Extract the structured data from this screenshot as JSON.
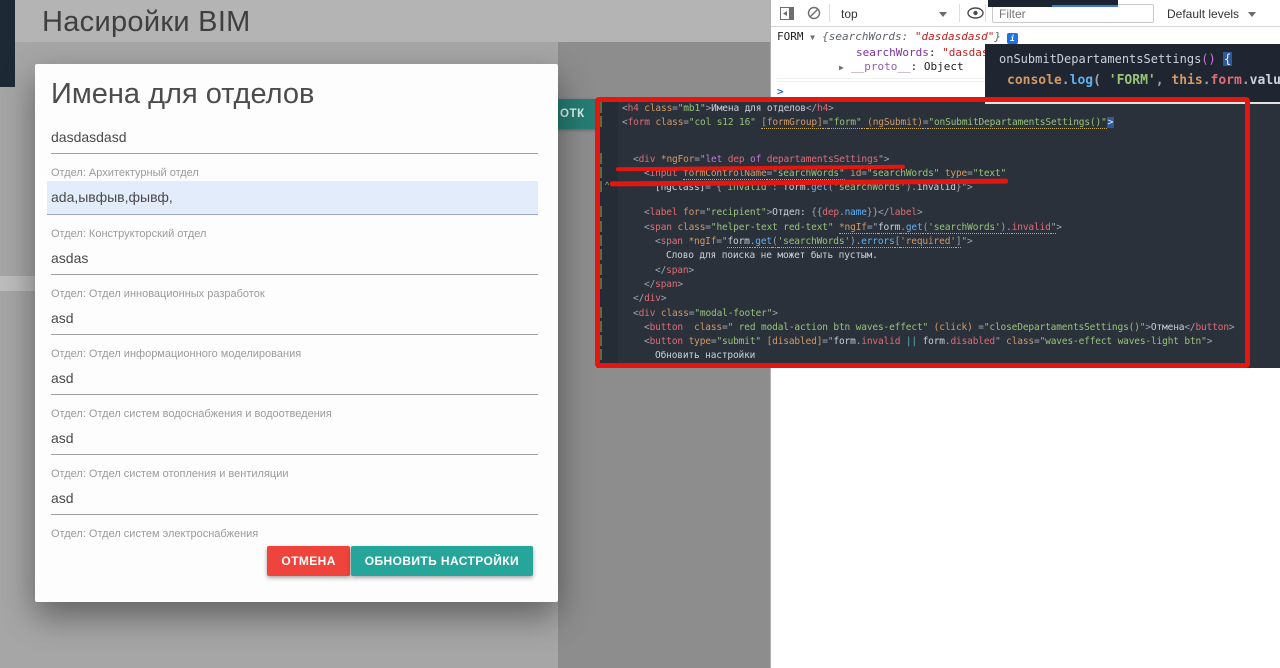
{
  "page": {
    "title": "Насиройки BIM",
    "open_button_label": "ОТК"
  },
  "modal": {
    "title": "Имена для отделов",
    "fields": [
      {
        "label": null,
        "value": "dasdasdasd",
        "highlighted": false
      },
      {
        "label": "Отдел: Архитектурный отдел",
        "value": "ada,ывфыв,фывф,",
        "highlighted": true
      },
      {
        "label": "Отдел: Конструкторский отдел",
        "value": "asdas",
        "highlighted": false
      },
      {
        "label": "Отдел: Отдел инновационных разработок",
        "value": "asd",
        "highlighted": false
      },
      {
        "label": "Отдел: Отдел информационного моделирования",
        "value": "asd",
        "highlighted": false
      },
      {
        "label": "Отдел: Отдел систем водоснабжения и водоотведения",
        "value": "asd",
        "highlighted": false
      },
      {
        "label": "Отдел: Отдел систем отопления и вентиляции",
        "value": "asd",
        "highlighted": false
      },
      {
        "label": "Отдел: Отдел систем электроснабжения",
        "value": null,
        "highlighted": false
      }
    ],
    "cancel_label": "ОТМЕНА",
    "submit_label": "ОБНОВИТЬ НАСТРОЙКИ",
    "colors": {
      "cancel": "#ef443b",
      "submit": "#26a69a",
      "highlight": "#e3ecfb"
    }
  },
  "devtools": {
    "toolbar": {
      "context_label": "top",
      "filter_placeholder": "Filter",
      "levels_label": "Default levels"
    },
    "console": {
      "entry_label": "FORM",
      "preview_open": "{",
      "preview_key": "searchWords: ",
      "preview_value": "\"dasdasdasd\"",
      "preview_close": "}",
      "child_key": "searchWords",
      "child_sep": ": ",
      "child_value": "\"dasdasdasd",
      "proto_label": "__proto__",
      "proto_sep": ": ",
      "proto_value": "Object",
      "prompt": ">"
    }
  },
  "popup": {
    "lines": [
      [
        [
          "x",
          "onSubmitDepartamentsSettings"
        ],
        [
          "k",
          "()"
        ],
        [
          "x",
          " "
        ],
        [
          "sel",
          "{"
        ]
      ],
      [
        [
          "a",
          "console"
        ],
        [
          "p",
          "."
        ],
        [
          "f",
          "log"
        ],
        [
          "p",
          "( "
        ],
        [
          "s",
          "'FORM'"
        ],
        [
          "p",
          ", "
        ],
        [
          "a",
          "this"
        ],
        [
          "p",
          "."
        ],
        [
          "i",
          "form"
        ],
        [
          "p",
          "."
        ],
        [
          "x",
          "value"
        ],
        [
          "p",
          ")"
        ]
      ]
    ]
  },
  "editor": {
    "lines": [
      {
        "ind": 0,
        "gut": true,
        "tok": [
          [
            "p",
            "<"
          ],
          [
            "t",
            "h4"
          ],
          [
            "x",
            " "
          ],
          [
            "a",
            "class"
          ],
          [
            "p",
            "="
          ],
          [
            "s",
            "\"mb1\""
          ],
          [
            "p",
            ">"
          ],
          [
            "x",
            "Имена для отделов"
          ],
          [
            "p",
            "</"
          ],
          [
            "t",
            "h4"
          ],
          [
            "p",
            ">"
          ]
        ]
      },
      {
        "ind": 0,
        "gut": true,
        "tok": [
          [
            "p",
            "<"
          ],
          [
            "t",
            "form"
          ],
          [
            "x",
            " "
          ],
          [
            "a",
            "class"
          ],
          [
            "p",
            "="
          ],
          [
            "s",
            "\"col s12 16\""
          ],
          [
            "x",
            " "
          ],
          [
            "a w",
            "[formGroup]"
          ],
          [
            "p w",
            "="
          ],
          [
            "s w",
            "\"form\""
          ],
          [
            "x w",
            " "
          ],
          [
            "a w",
            "(ngSubmit)"
          ],
          [
            "p w",
            "="
          ],
          [
            "s w",
            "\"onSubmitDepartamentsSettings()\""
          ],
          [
            "sel",
            ">"
          ]
        ]
      },
      {
        "blank": true,
        "h": 22
      },
      {
        "ind": 2,
        "gut": true,
        "tok": [
          [
            "p",
            "<"
          ],
          [
            "t",
            "div"
          ],
          [
            "x",
            " "
          ],
          [
            "a",
            "*ngFor"
          ],
          [
            "p",
            "=\""
          ],
          [
            "k",
            "let"
          ],
          [
            "x",
            " "
          ],
          [
            "i",
            "dep"
          ],
          [
            "x",
            " "
          ],
          [
            "k",
            "of"
          ],
          [
            "x",
            " "
          ],
          [
            "i",
            "departamentsSettings"
          ],
          [
            "p",
            "\">"
          ]
        ]
      },
      {
        "ind": 4,
        "gut": true,
        "tok": [
          [
            "p",
            "<"
          ],
          [
            "t",
            "input"
          ],
          [
            "x",
            " "
          ],
          [
            "a w",
            "formControlName"
          ],
          [
            "p w",
            "="
          ],
          [
            "s w",
            "\"searchWords\""
          ],
          [
            "x",
            " "
          ],
          [
            "a",
            "id"
          ],
          [
            "p",
            "="
          ],
          [
            "s",
            "\"searchWords\""
          ],
          [
            "x",
            " "
          ],
          [
            "a",
            "type"
          ],
          [
            "p",
            "="
          ],
          [
            "s",
            "\"text\""
          ]
        ]
      },
      {
        "ind": 6,
        "gut": true,
        "fold": true,
        "tok": [
          [
            "x",
            "[ngClass]"
          ],
          [
            "p",
            "=\"{"
          ],
          [
            "s",
            "'invalid'"
          ],
          [
            "p",
            ": "
          ],
          [
            "x",
            "form"
          ],
          [
            "p",
            "."
          ],
          [
            "f",
            "get"
          ],
          [
            "p",
            "("
          ],
          [
            "s",
            "'searchWords'"
          ],
          [
            "p",
            ")."
          ],
          [
            "x",
            "invalid"
          ],
          [
            "p",
            "}\">"
          ]
        ]
      },
      {
        "blank": true,
        "h": 11
      },
      {
        "ind": 4,
        "gut": true,
        "tok": [
          [
            "p",
            "<"
          ],
          [
            "t",
            "label"
          ],
          [
            "x",
            " "
          ],
          [
            "a",
            "for"
          ],
          [
            "p",
            "="
          ],
          [
            "s",
            "\"recipient\""
          ],
          [
            "p",
            ">"
          ],
          [
            "x",
            "Отдел: "
          ],
          [
            "p",
            "{{"
          ],
          [
            "i",
            "dep"
          ],
          [
            "p",
            "."
          ],
          [
            "f",
            "name"
          ],
          [
            "p",
            "}}"
          ],
          [
            "p",
            "</"
          ],
          [
            "t",
            "label"
          ],
          [
            "p",
            ">"
          ]
        ]
      },
      {
        "ind": 4,
        "gut": true,
        "tok": [
          [
            "p",
            "<"
          ],
          [
            "t",
            "span"
          ],
          [
            "x",
            " "
          ],
          [
            "a",
            "class"
          ],
          [
            "p",
            "="
          ],
          [
            "s",
            "\"helper-text red-text\""
          ],
          [
            "x",
            " "
          ],
          [
            "a w",
            "*ngIf"
          ],
          [
            "p w",
            "=\""
          ],
          [
            "x w",
            "form"
          ],
          [
            "p w",
            "."
          ],
          [
            "f w",
            "get"
          ],
          [
            "p w",
            "("
          ],
          [
            "s w",
            "'searchWords'"
          ],
          [
            "p w",
            ")."
          ],
          [
            "i w",
            "invalid"
          ],
          [
            "p w",
            "\""
          ],
          [
            "p",
            ">"
          ]
        ]
      },
      {
        "ind": 6,
        "gut": true,
        "tok": [
          [
            "p",
            "<"
          ],
          [
            "t",
            "span"
          ],
          [
            "x",
            " "
          ],
          [
            "a",
            "*ngIf"
          ],
          [
            "p",
            "=\""
          ],
          [
            "x w",
            "form"
          ],
          [
            "p w",
            "."
          ],
          [
            "f w",
            "get"
          ],
          [
            "p w",
            "("
          ],
          [
            "s w",
            "'searchWords'"
          ],
          [
            "p w",
            ")."
          ],
          [
            "f w",
            "errors"
          ],
          [
            "p w",
            "["
          ],
          [
            "a w",
            "'required'"
          ],
          [
            "p w",
            "]"
          ],
          [
            "p",
            "\">"
          ]
        ]
      },
      {
        "ind": 8,
        "gut": true,
        "tok": [
          [
            "x",
            "Слово для поиска не может быть пустым."
          ]
        ]
      },
      {
        "ind": 6,
        "gut": true,
        "tok": [
          [
            "p",
            "</"
          ],
          [
            "t",
            "span"
          ],
          [
            "p",
            ">"
          ]
        ]
      },
      {
        "ind": 4,
        "gut": true,
        "tok": [
          [
            "p",
            "</"
          ],
          [
            "t",
            "span"
          ],
          [
            "p",
            ">"
          ]
        ]
      },
      {
        "ind": 2,
        "gut": false,
        "tok": [
          [
            "p",
            "</"
          ],
          [
            "t",
            "div"
          ],
          [
            "p",
            ">"
          ]
        ]
      },
      {
        "ind": 2,
        "gut": true,
        "tok": [
          [
            "p",
            "<"
          ],
          [
            "t",
            "div"
          ],
          [
            "x",
            " "
          ],
          [
            "a",
            "class"
          ],
          [
            "p",
            "="
          ],
          [
            "s",
            "\"modal-footer\""
          ],
          [
            "p",
            ">"
          ]
        ]
      },
      {
        "ind": 4,
        "gut": true,
        "tok": [
          [
            "p",
            "<"
          ],
          [
            "t",
            "button"
          ],
          [
            "x",
            "  "
          ],
          [
            "a",
            "class"
          ],
          [
            "p",
            "="
          ],
          [
            "s",
            "\" red modal-action btn waves-effect\""
          ],
          [
            "x",
            " "
          ],
          [
            "a",
            "(click)"
          ],
          [
            "x",
            " "
          ],
          [
            "p",
            "="
          ],
          [
            "s",
            "\"closeDepartamentsSettings()\""
          ],
          [
            "p",
            ">"
          ],
          [
            "x",
            "Отмена"
          ],
          [
            "p",
            "</"
          ],
          [
            "t",
            "button"
          ],
          [
            "p",
            ">"
          ]
        ]
      },
      {
        "ind": 4,
        "gut": true,
        "tok": [
          [
            "p",
            "<"
          ],
          [
            "t",
            "button"
          ],
          [
            "x",
            " "
          ],
          [
            "a",
            "type"
          ],
          [
            "p",
            "="
          ],
          [
            "s",
            "\"submit\""
          ],
          [
            "x",
            " "
          ],
          [
            "a",
            "[disabled]"
          ],
          [
            "p",
            "=\""
          ],
          [
            "x",
            "form"
          ],
          [
            "p",
            "."
          ],
          [
            "i",
            "invalid"
          ],
          [
            "x",
            " "
          ],
          [
            "o",
            "||"
          ],
          [
            "x",
            " form"
          ],
          [
            "p",
            "."
          ],
          [
            "i",
            "disabled"
          ],
          [
            "p",
            "\""
          ],
          [
            "x",
            " "
          ],
          [
            "a",
            "class"
          ],
          [
            "p",
            "="
          ],
          [
            "s",
            "\"waves-effect waves-light btn\""
          ],
          [
            "p",
            ">"
          ]
        ]
      },
      {
        "ind": 6,
        "gut": true,
        "tok": [
          [
            "x",
            "Обновить настройки"
          ]
        ]
      }
    ]
  }
}
